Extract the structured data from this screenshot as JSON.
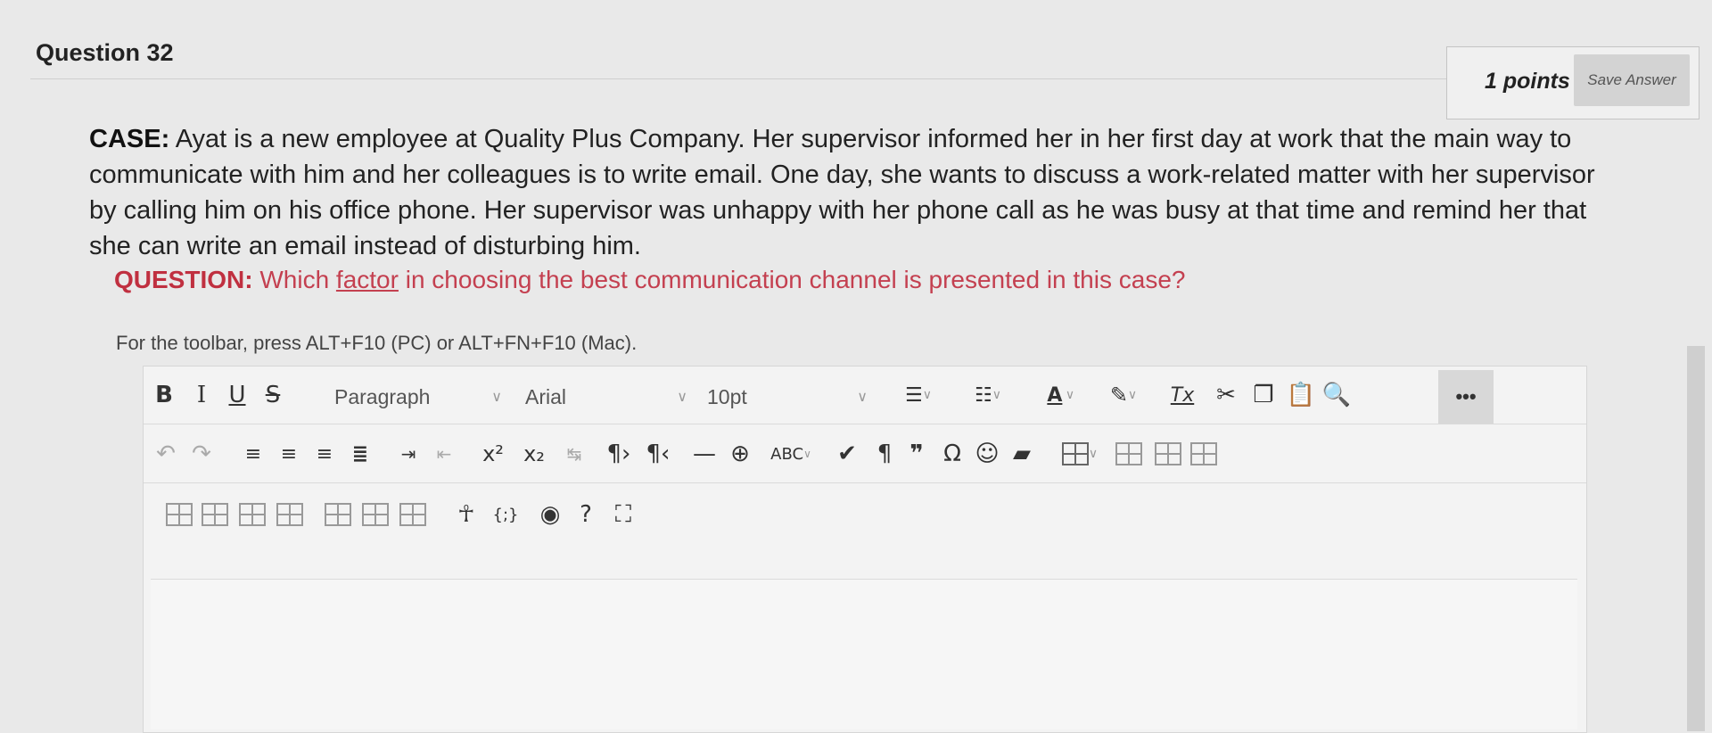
{
  "question": {
    "title": "Question 32",
    "points": "1 points",
    "save_label": "Save Answer"
  },
  "case": {
    "label": "CASE:",
    "text": " Ayat is a new employee at Quality Plus Company. Her supervisor informed her in her first day at work that the main way to communicate with him and her colleagues is to write email. One day, she wants to discuss a work-related matter with her supervisor by calling him on his office phone. Her supervisor was unhappy with her phone call as he was busy at that time and remind her that she can write an email instead of disturbing him."
  },
  "prompt": {
    "label": "QUESTION:",
    "text_before": " Which ",
    "underlined": "factor",
    "text_after": " in choosing the best communication channel is presented in this case?"
  },
  "editor": {
    "hint": "For the toolbar, press ALT+F10 (PC) or ALT+FN+F10 (Mac).",
    "block_format": "Paragraph",
    "font_family": "Arial",
    "font_size": "10pt",
    "more_label": "•••",
    "glyphs": {
      "bold": "B",
      "italic": "I",
      "underline": "U",
      "strike": "S",
      "superscript": "x²",
      "subscript": "x₂",
      "font_color": "A",
      "clear_format": "Tx",
      "omega": "Ω",
      "pilcrow": "¶",
      "quote": "❞",
      "code": "{;}",
      "accessibility": "♿"
    }
  },
  "icons": [
    "bold-icon",
    "italic-icon",
    "underline-icon",
    "strikethrough-icon",
    "bullet-list-icon",
    "numbered-list-icon",
    "font-color-icon",
    "highlight-icon",
    "clear-formatting-icon",
    "cut-icon",
    "copy-icon",
    "paste-icon",
    "search-icon",
    "undo-icon",
    "redo-icon",
    "align-left-icon",
    "align-center-icon",
    "align-right-icon",
    "justify-icon",
    "indent-icon",
    "outdent-icon",
    "superscript-icon",
    "subscript-icon",
    "ltr-icon",
    "rtl-icon",
    "horizontal-rule-icon",
    "insert-icon",
    "spellcheck-icon",
    "pilcrow-icon",
    "quote-icon",
    "omega-icon",
    "emoji-icon",
    "bookmark-icon",
    "table-icon",
    "accessibility-icon",
    "code-icon",
    "preview-icon",
    "help-icon",
    "fullscreen-icon"
  ]
}
